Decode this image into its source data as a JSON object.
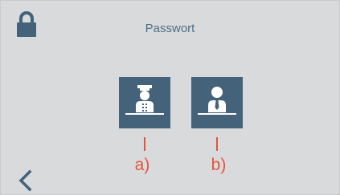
{
  "header": {
    "title": "Passwort",
    "lock_icon": "lock-icon"
  },
  "roles": [
    {
      "icon": "service-staff-icon",
      "marker": "a)"
    },
    {
      "icon": "employee-icon",
      "marker": "b)"
    }
  ],
  "footer": {
    "back_icon": "chevron-left-icon"
  },
  "colors": {
    "background": "#d9dadb",
    "accent": "#44627a",
    "title_text": "#4f6d84",
    "marker": "#e5533c"
  }
}
